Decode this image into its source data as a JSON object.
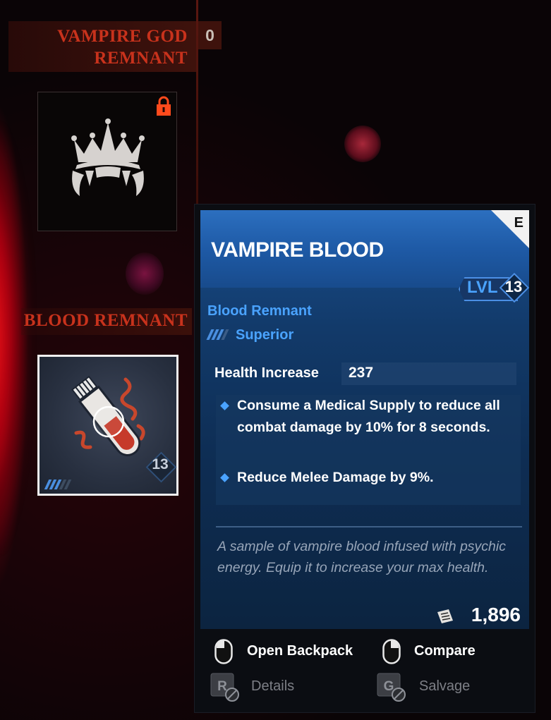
{
  "theme": {
    "accent_red": "#c8321c",
    "accent_blue": "#4aa3ff",
    "card_blue": "#1a4f8f"
  },
  "god_remnant": {
    "title_line1": "VAMPIRE GOD",
    "title_line2": "REMNANT",
    "count": "0",
    "icon": "crown-fangs-icon",
    "locked": true
  },
  "blood_remnant": {
    "title": "BLOOD REMNANT",
    "slot_level": "13",
    "icon": "blood-vial-icon",
    "rarity_tier": 3
  },
  "tooltip": {
    "grade": "E",
    "name": "VAMPIRE BLOOD",
    "level_label": "LVL",
    "level": "13",
    "category": "Blood Remnant",
    "rarity": "Superior",
    "stat_label": "Health Increase",
    "stat_value": "237",
    "perks": [
      "Consume a Medical Supply to reduce all combat damage by 10% for 8 seconds.",
      "Reduce Melee Damage by 9%."
    ],
    "description": "A sample of vampire blood infused with psychic energy. Equip it to increase your max health.",
    "price": "1,896",
    "price_icon": "scrap-currency-icon"
  },
  "controls": {
    "open_backpack": "Open Backpack",
    "compare": "Compare",
    "details_key": "R",
    "details": "Details",
    "salvage_key": "G",
    "salvage": "Salvage"
  }
}
